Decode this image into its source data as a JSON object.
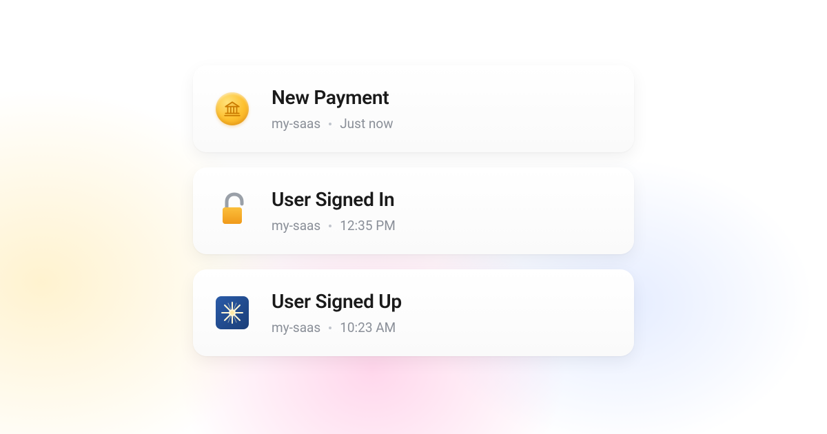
{
  "notifications": [
    {
      "icon": "bank-coin",
      "title": "New Payment",
      "source": "my-saas",
      "time": "Just now"
    },
    {
      "icon": "unlocked-padlock",
      "title": "User Signed In",
      "source": "my-saas",
      "time": "12:35 PM"
    },
    {
      "icon": "spark-tile",
      "title": "User Signed Up",
      "source": "my-saas",
      "time": "10:23 AM"
    }
  ]
}
